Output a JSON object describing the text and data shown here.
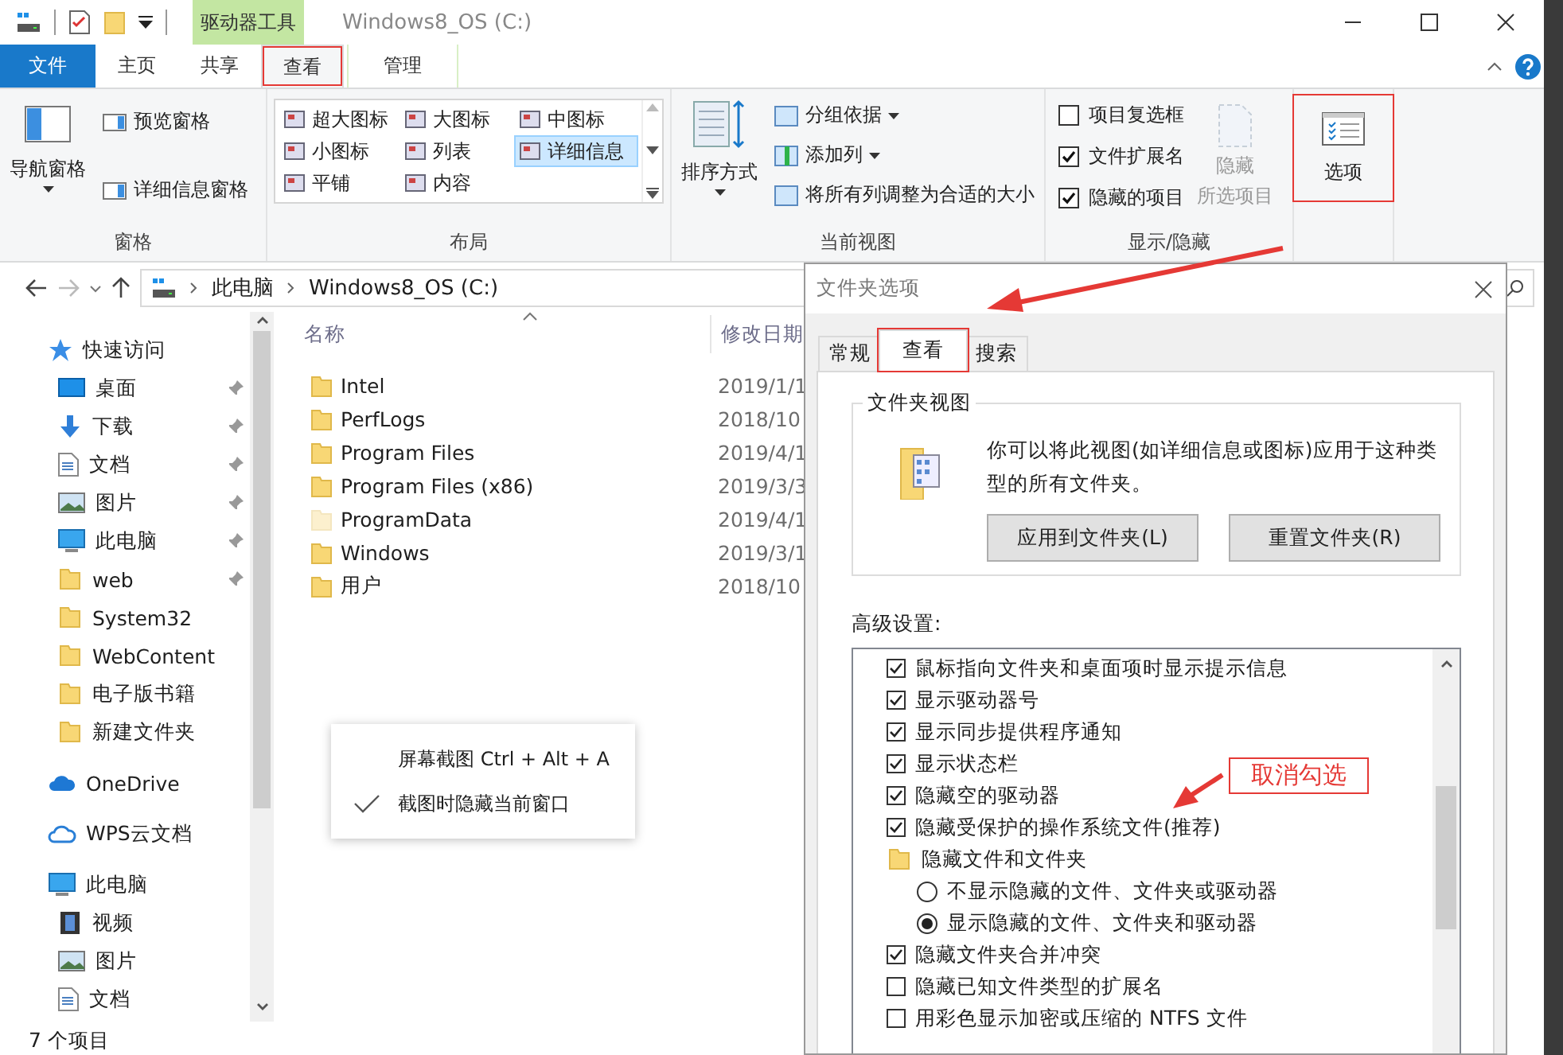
{
  "title_bar": {
    "context_tab": "驱动器工具",
    "title": "Windows8_OS (C:)"
  },
  "ribbon_tabs": [
    {
      "label": "文件",
      "kind": "file",
      "selected": false,
      "highlighted": false
    },
    {
      "label": "主页",
      "kind": "plain",
      "selected": false,
      "highlighted": false
    },
    {
      "label": "共享",
      "kind": "plain",
      "selected": false,
      "highlighted": false
    },
    {
      "label": "查看",
      "kind": "plain",
      "selected": true,
      "highlighted": true
    },
    {
      "label": "管理",
      "kind": "context",
      "selected": false,
      "highlighted": false
    }
  ],
  "ribbon": {
    "panes": {
      "name": "窗格",
      "large": "导航窗格",
      "small": [
        "预览窗格",
        "详细信息窗格"
      ]
    },
    "layout": {
      "name": "布局",
      "items": [
        {
          "label": "超大图标",
          "selected": false
        },
        {
          "label": "大图标",
          "selected": false
        },
        {
          "label": "中图标",
          "selected": false
        },
        {
          "label": "小图标",
          "selected": false
        },
        {
          "label": "列表",
          "selected": false
        },
        {
          "label": "详细信息",
          "selected": true
        },
        {
          "label": "平铺",
          "selected": false
        },
        {
          "label": "内容",
          "selected": false
        }
      ]
    },
    "current_view": {
      "name": "当前视图",
      "sort": "排序方式",
      "items": [
        {
          "label": "分组依据",
          "dropdown": true
        },
        {
          "label": "添加列",
          "dropdown": true
        },
        {
          "label": "将所有列调整为合适的大小",
          "dropdown": false
        }
      ]
    },
    "show_hide": {
      "name": "显示/隐藏",
      "checkboxes": [
        {
          "label": "项目复选框",
          "checked": false
        },
        {
          "label": "文件扩展名",
          "checked": true
        },
        {
          "label": "隐藏的项目",
          "checked": true
        }
      ],
      "hide_selected": {
        "lines": [
          "隐藏",
          "所选项目"
        ],
        "disabled": true
      }
    },
    "options": {
      "label": "选项",
      "highlighted": true
    }
  },
  "address_bar": {
    "path": [
      "此电脑",
      "Windows8_OS (C:)"
    ]
  },
  "nav_pane": {
    "sections": [
      {
        "label": "快速访问",
        "children": [
          {
            "label": "桌面",
            "pinned": true
          },
          {
            "label": "下载",
            "pinned": true
          },
          {
            "label": "文档",
            "pinned": true
          },
          {
            "label": "图片",
            "pinned": true
          },
          {
            "label": "此电脑",
            "pinned": true
          },
          {
            "label": "web",
            "pinned": true
          },
          {
            "label": "System32",
            "pinned": false
          },
          {
            "label": "WebContent",
            "pinned": false
          },
          {
            "label": "电子版书籍",
            "pinned": false
          },
          {
            "label": "新建文件夹",
            "pinned": false
          }
        ]
      },
      {
        "label": "OneDrive"
      },
      {
        "label": "WPS云文档"
      },
      {
        "label": "此电脑",
        "children": [
          {
            "label": "视频",
            "pinned": false
          },
          {
            "label": "图片",
            "pinned": false
          },
          {
            "label": "文档",
            "pinned": false
          }
        ]
      }
    ]
  },
  "file_list": {
    "columns": [
      "名称",
      "修改日期"
    ],
    "rows": [
      {
        "name": "Intel",
        "modified": "2019/1/1",
        "faded": false
      },
      {
        "name": "PerfLogs",
        "modified": "2018/10",
        "faded": false
      },
      {
        "name": "Program Files",
        "modified": "2019/4/1",
        "faded": false
      },
      {
        "name": "Program Files (x86)",
        "modified": "2019/3/3",
        "faded": false
      },
      {
        "name": "ProgramData",
        "modified": "2019/4/1",
        "faded": true
      },
      {
        "name": "Windows",
        "modified": "2019/3/1",
        "faded": false
      },
      {
        "name": "用户",
        "modified": "2018/10",
        "faded": false
      }
    ]
  },
  "context_menu": {
    "items": [
      {
        "label": "屏幕截图 Ctrl + Alt + A",
        "checked": false
      },
      {
        "label": "截图时隐藏当前窗口",
        "checked": true
      }
    ]
  },
  "status_bar": {
    "text": "7 个项目"
  },
  "dialog": {
    "title": "文件夹选项",
    "tabs": [
      {
        "label": "常规",
        "selected": false,
        "highlighted": false
      },
      {
        "label": "查看",
        "selected": true,
        "highlighted": true
      },
      {
        "label": "搜索",
        "selected": false,
        "highlighted": false
      }
    ],
    "folder_view": {
      "title": "文件夹视图",
      "text": "你可以将此视图(如详细信息或图标)应用于这种类型的所有文件夹。",
      "buttons": [
        "应用到文件夹(L)",
        "重置文件夹(R)"
      ]
    },
    "advanced_label": "高级设置:",
    "advanced": [
      {
        "kind": "checkbox",
        "label": "鼠标指向文件夹和桌面项时显示提示信息",
        "checked": true
      },
      {
        "kind": "checkbox",
        "label": "显示驱动器号",
        "checked": true
      },
      {
        "kind": "checkbox",
        "label": "显示同步提供程序通知",
        "checked": true
      },
      {
        "kind": "checkbox",
        "label": "显示状态栏",
        "checked": true
      },
      {
        "kind": "checkbox",
        "label": "隐藏空的驱动器",
        "checked": true
      },
      {
        "kind": "checkbox",
        "label": "隐藏受保护的操作系统文件(推荐)",
        "checked": true
      },
      {
        "kind": "folder",
        "label": "隐藏文件和文件夹"
      },
      {
        "kind": "radio",
        "label": "不显示隐藏的文件、文件夹或驱动器",
        "selected": false
      },
      {
        "kind": "radio",
        "label": "显示隐藏的文件、文件夹和驱动器",
        "selected": true
      },
      {
        "kind": "checkbox",
        "label": "隐藏文件夹合并冲突",
        "checked": true
      },
      {
        "kind": "checkbox",
        "label": "隐藏已知文件类型的扩展名",
        "checked": false
      },
      {
        "kind": "checkbox",
        "label": "用彩色显示加密或压缩的 NTFS 文件",
        "checked": false
      }
    ]
  },
  "annotation": {
    "text": "取消勾选"
  }
}
